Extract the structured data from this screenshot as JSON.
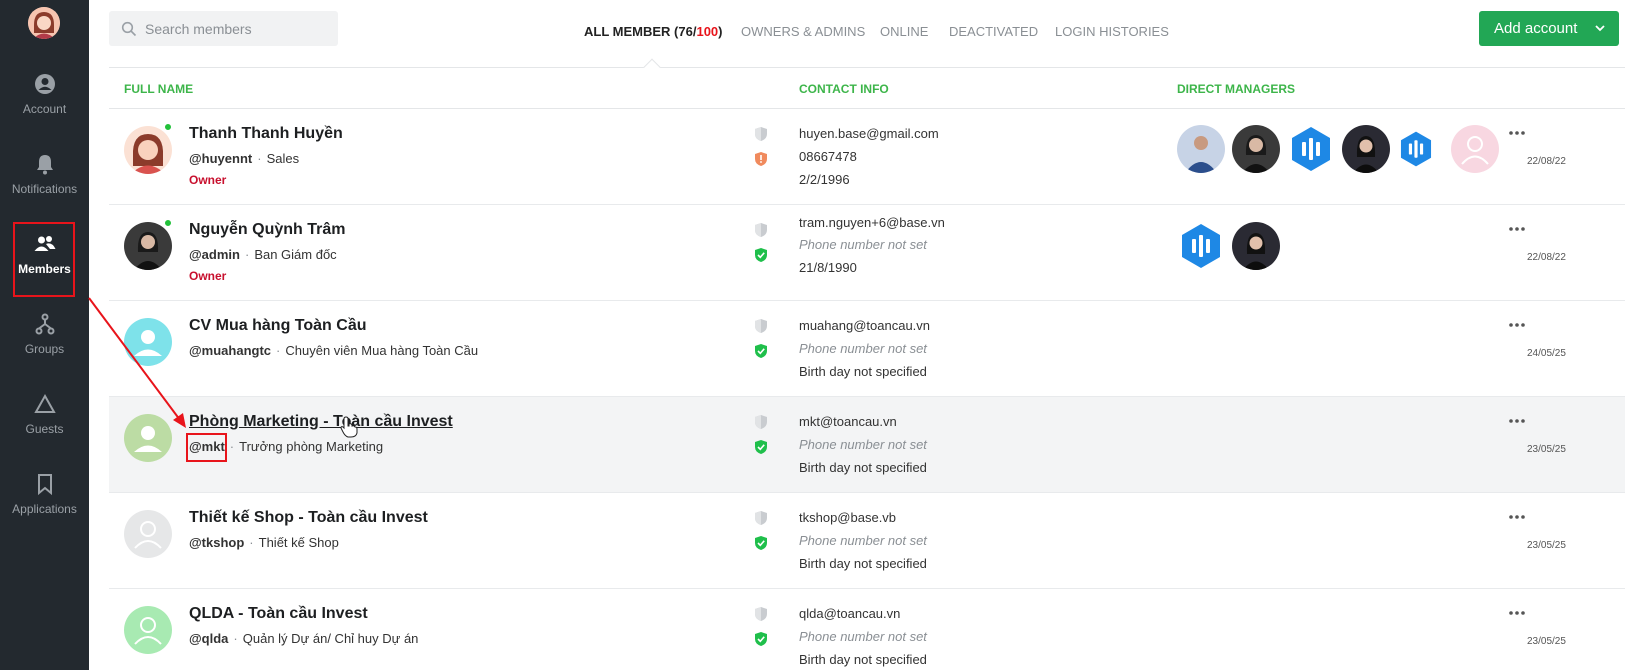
{
  "sidebar": {
    "items": [
      {
        "label": "Account",
        "icon": "account-icon"
      },
      {
        "label": "Notifications",
        "icon": "bell-icon"
      },
      {
        "label": "Members",
        "icon": "members-icon"
      },
      {
        "label": "Groups",
        "icon": "groups-icon"
      },
      {
        "label": "Guests",
        "icon": "triangle-icon"
      },
      {
        "label": "Applications",
        "icon": "bookmark-icon"
      }
    ],
    "active": "Members"
  },
  "search": {
    "placeholder": "Search members"
  },
  "tabs": {
    "all_prefix": "ALL MEMBER (",
    "all_count": "76",
    "all_sep": "/",
    "all_total": "100",
    "all_suffix": ")",
    "owners": "OWNERS & ADMINS",
    "online": "ONLINE",
    "deactivated": "DEACTIVATED",
    "login": "LOGIN HISTORIES"
  },
  "add_button": {
    "label": "Add account"
  },
  "columns": {
    "full_name": "FULL NAME",
    "contact": "CONTACT INFO",
    "managers": "DIRECT MANAGERS"
  },
  "colors": {
    "accent": "#22a755",
    "header_green": "#3db54a",
    "owner_red": "#c8102e",
    "sidebar": "#23292f"
  },
  "members": [
    {
      "name": "Thanh Thanh Huyền",
      "username": "@huyennt",
      "title": "Sales",
      "role": "Owner",
      "email": "huyen.base@gmail.com",
      "phone": "08667478",
      "birthday": "2/2/1996",
      "date": "22/08/22"
    },
    {
      "name": "Nguyễn Quỳnh Trâm",
      "username": "@admin",
      "title": "Ban Giám đốc",
      "role": "Owner",
      "email": "tram.nguyen+6@base.vn",
      "phone": "Phone number not set",
      "birthday": "21/8/1990",
      "date": "22/08/22"
    },
    {
      "name": "CV Mua hàng Toàn Cầu",
      "username": "@muahangtc",
      "title": "Chuyên viên Mua hàng Toàn Cầu",
      "role": "",
      "email": "muahang@toancau.vn",
      "phone": "Phone number not set",
      "birthday": "Birth day not specified",
      "date": "24/05/25"
    },
    {
      "name": "Phòng Marketing - Toàn cầu Invest",
      "username": "@mkt",
      "title": "Trưởng phòng Marketing",
      "role": "",
      "email": "mkt@toancau.vn",
      "phone": "Phone number not set",
      "birthday": "Birth day not specified",
      "date": "23/05/25"
    },
    {
      "name": "Thiết kế Shop - Toàn cầu Invest",
      "username": "@tkshop",
      "title": "Thiết kế Shop",
      "role": "",
      "email": "tkshop@base.vb",
      "phone": "Phone number not set",
      "birthday": "Birth day not specified",
      "date": "23/05/25"
    },
    {
      "name": "QLDA - Toàn cầu Invest",
      "username": "@qlda",
      "title": "Quản lý Dự án/ Chỉ huy Dự án",
      "role": "",
      "email": "qlda@toancau.vn",
      "phone": "Phone number not set",
      "birthday": "Birth day not specified",
      "date": "23/05/25"
    }
  ]
}
